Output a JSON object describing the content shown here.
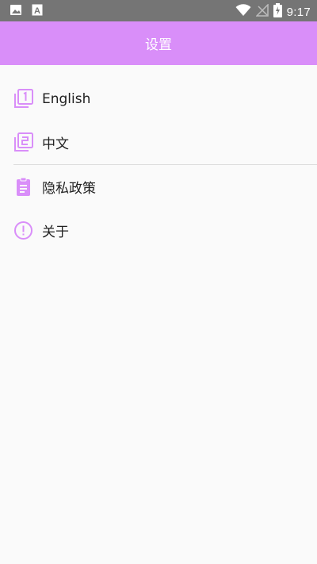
{
  "status_bar": {
    "time": "9:17",
    "icons": [
      "image-icon",
      "text-a-icon",
      "wifi-icon",
      "no-signal-icon",
      "battery-charging-icon"
    ]
  },
  "app_bar": {
    "title": "设置",
    "color": "#d98ef9"
  },
  "menu": {
    "items": [
      {
        "label": "English",
        "icon": "filter-1-icon"
      },
      {
        "label": "中文",
        "icon": "filter-2-icon"
      },
      {
        "label": "隐私政策",
        "icon": "clipboard-icon"
      },
      {
        "label": "关于",
        "icon": "info-exclamation-icon"
      }
    ],
    "icon_color": "#d98ef9"
  }
}
